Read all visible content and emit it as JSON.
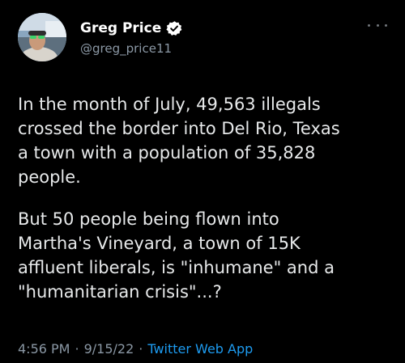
{
  "author": {
    "display_name": "Greg Price",
    "handle": "@greg_price11",
    "verified": true
  },
  "more_icon": "ellipsis-icon",
  "tweet": {
    "paragraphs": [
      {
        "lines": [
          "In the month of July, 49,563 illegals",
          "crossed the border into Del Rio, Texas",
          "a town with a population of 35,828",
          "people."
        ]
      },
      {
        "lines": [
          "But 50 people being flown into",
          "Martha's Vineyard, a town of 15K",
          "affluent liberals, is \"inhumane\" and a",
          "\"humanitarian crisis\"...?"
        ]
      }
    ]
  },
  "meta": {
    "time": "4:56 PM",
    "date": "9/15/22",
    "separator": "·",
    "source": "Twitter Web App"
  },
  "colors": {
    "background": "#000000",
    "text": "#e7e9ea",
    "secondary_text": "#8b98a5",
    "accent": "#1d9bf0"
  }
}
